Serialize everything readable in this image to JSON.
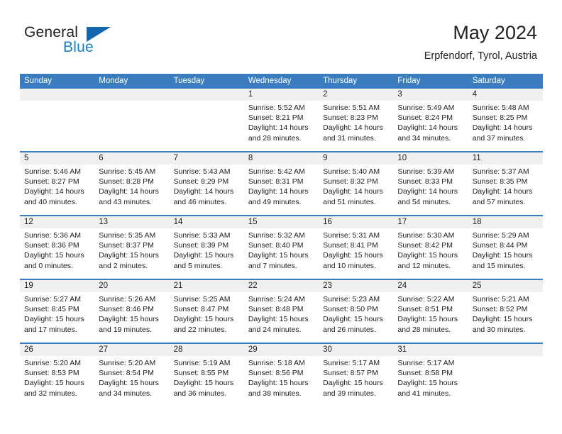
{
  "brand": {
    "name_part1": "General",
    "name_part2": "Blue",
    "accent_color": "#1566b0",
    "logo_icon": "triangle-flag-icon"
  },
  "header": {
    "title": "May 2024",
    "location": "Erpfendorf, Tyrol, Austria"
  },
  "theme": {
    "header_row_bg": "#3a7dbf",
    "week_separator": "#3a7dbf",
    "day_band_bg": "#f0f0f0",
    "text": "#222222"
  },
  "weekdays": [
    "Sunday",
    "Monday",
    "Tuesday",
    "Wednesday",
    "Thursday",
    "Friday",
    "Saturday"
  ],
  "weeks": [
    {
      "days": [
        {
          "number": "",
          "sunrise": "",
          "sunset": "",
          "daylight_line1": "",
          "daylight_line2": "",
          "empty": true
        },
        {
          "number": "",
          "sunrise": "",
          "sunset": "",
          "daylight_line1": "",
          "daylight_line2": "",
          "empty": true
        },
        {
          "number": "",
          "sunrise": "",
          "sunset": "",
          "daylight_line1": "",
          "daylight_line2": "",
          "empty": true
        },
        {
          "number": "1",
          "sunrise": "Sunrise: 5:52 AM",
          "sunset": "Sunset: 8:21 PM",
          "daylight_line1": "Daylight: 14 hours",
          "daylight_line2": "and 28 minutes.",
          "empty": false
        },
        {
          "number": "2",
          "sunrise": "Sunrise: 5:51 AM",
          "sunset": "Sunset: 8:23 PM",
          "daylight_line1": "Daylight: 14 hours",
          "daylight_line2": "and 31 minutes.",
          "empty": false
        },
        {
          "number": "3",
          "sunrise": "Sunrise: 5:49 AM",
          "sunset": "Sunset: 8:24 PM",
          "daylight_line1": "Daylight: 14 hours",
          "daylight_line2": "and 34 minutes.",
          "empty": false
        },
        {
          "number": "4",
          "sunrise": "Sunrise: 5:48 AM",
          "sunset": "Sunset: 8:25 PM",
          "daylight_line1": "Daylight: 14 hours",
          "daylight_line2": "and 37 minutes.",
          "empty": false
        }
      ]
    },
    {
      "days": [
        {
          "number": "5",
          "sunrise": "Sunrise: 5:46 AM",
          "sunset": "Sunset: 8:27 PM",
          "daylight_line1": "Daylight: 14 hours",
          "daylight_line2": "and 40 minutes.",
          "empty": false
        },
        {
          "number": "6",
          "sunrise": "Sunrise: 5:45 AM",
          "sunset": "Sunset: 8:28 PM",
          "daylight_line1": "Daylight: 14 hours",
          "daylight_line2": "and 43 minutes.",
          "empty": false
        },
        {
          "number": "7",
          "sunrise": "Sunrise: 5:43 AM",
          "sunset": "Sunset: 8:29 PM",
          "daylight_line1": "Daylight: 14 hours",
          "daylight_line2": "and 46 minutes.",
          "empty": false
        },
        {
          "number": "8",
          "sunrise": "Sunrise: 5:42 AM",
          "sunset": "Sunset: 8:31 PM",
          "daylight_line1": "Daylight: 14 hours",
          "daylight_line2": "and 49 minutes.",
          "empty": false
        },
        {
          "number": "9",
          "sunrise": "Sunrise: 5:40 AM",
          "sunset": "Sunset: 8:32 PM",
          "daylight_line1": "Daylight: 14 hours",
          "daylight_line2": "and 51 minutes.",
          "empty": false
        },
        {
          "number": "10",
          "sunrise": "Sunrise: 5:39 AM",
          "sunset": "Sunset: 8:33 PM",
          "daylight_line1": "Daylight: 14 hours",
          "daylight_line2": "and 54 minutes.",
          "empty": false
        },
        {
          "number": "11",
          "sunrise": "Sunrise: 5:37 AM",
          "sunset": "Sunset: 8:35 PM",
          "daylight_line1": "Daylight: 14 hours",
          "daylight_line2": "and 57 minutes.",
          "empty": false
        }
      ]
    },
    {
      "days": [
        {
          "number": "12",
          "sunrise": "Sunrise: 5:36 AM",
          "sunset": "Sunset: 8:36 PM",
          "daylight_line1": "Daylight: 15 hours",
          "daylight_line2": "and 0 minutes.",
          "empty": false
        },
        {
          "number": "13",
          "sunrise": "Sunrise: 5:35 AM",
          "sunset": "Sunset: 8:37 PM",
          "daylight_line1": "Daylight: 15 hours",
          "daylight_line2": "and 2 minutes.",
          "empty": false
        },
        {
          "number": "14",
          "sunrise": "Sunrise: 5:33 AM",
          "sunset": "Sunset: 8:39 PM",
          "daylight_line1": "Daylight: 15 hours",
          "daylight_line2": "and 5 minutes.",
          "empty": false
        },
        {
          "number": "15",
          "sunrise": "Sunrise: 5:32 AM",
          "sunset": "Sunset: 8:40 PM",
          "daylight_line1": "Daylight: 15 hours",
          "daylight_line2": "and 7 minutes.",
          "empty": false
        },
        {
          "number": "16",
          "sunrise": "Sunrise: 5:31 AM",
          "sunset": "Sunset: 8:41 PM",
          "daylight_line1": "Daylight: 15 hours",
          "daylight_line2": "and 10 minutes.",
          "empty": false
        },
        {
          "number": "17",
          "sunrise": "Sunrise: 5:30 AM",
          "sunset": "Sunset: 8:42 PM",
          "daylight_line1": "Daylight: 15 hours",
          "daylight_line2": "and 12 minutes.",
          "empty": false
        },
        {
          "number": "18",
          "sunrise": "Sunrise: 5:29 AM",
          "sunset": "Sunset: 8:44 PM",
          "daylight_line1": "Daylight: 15 hours",
          "daylight_line2": "and 15 minutes.",
          "empty": false
        }
      ]
    },
    {
      "days": [
        {
          "number": "19",
          "sunrise": "Sunrise: 5:27 AM",
          "sunset": "Sunset: 8:45 PM",
          "daylight_line1": "Daylight: 15 hours",
          "daylight_line2": "and 17 minutes.",
          "empty": false
        },
        {
          "number": "20",
          "sunrise": "Sunrise: 5:26 AM",
          "sunset": "Sunset: 8:46 PM",
          "daylight_line1": "Daylight: 15 hours",
          "daylight_line2": "and 19 minutes.",
          "empty": false
        },
        {
          "number": "21",
          "sunrise": "Sunrise: 5:25 AM",
          "sunset": "Sunset: 8:47 PM",
          "daylight_line1": "Daylight: 15 hours",
          "daylight_line2": "and 22 minutes.",
          "empty": false
        },
        {
          "number": "22",
          "sunrise": "Sunrise: 5:24 AM",
          "sunset": "Sunset: 8:48 PM",
          "daylight_line1": "Daylight: 15 hours",
          "daylight_line2": "and 24 minutes.",
          "empty": false
        },
        {
          "number": "23",
          "sunrise": "Sunrise: 5:23 AM",
          "sunset": "Sunset: 8:50 PM",
          "daylight_line1": "Daylight: 15 hours",
          "daylight_line2": "and 26 minutes.",
          "empty": false
        },
        {
          "number": "24",
          "sunrise": "Sunrise: 5:22 AM",
          "sunset": "Sunset: 8:51 PM",
          "daylight_line1": "Daylight: 15 hours",
          "daylight_line2": "and 28 minutes.",
          "empty": false
        },
        {
          "number": "25",
          "sunrise": "Sunrise: 5:21 AM",
          "sunset": "Sunset: 8:52 PM",
          "daylight_line1": "Daylight: 15 hours",
          "daylight_line2": "and 30 minutes.",
          "empty": false
        }
      ]
    },
    {
      "days": [
        {
          "number": "26",
          "sunrise": "Sunrise: 5:20 AM",
          "sunset": "Sunset: 8:53 PM",
          "daylight_line1": "Daylight: 15 hours",
          "daylight_line2": "and 32 minutes.",
          "empty": false
        },
        {
          "number": "27",
          "sunrise": "Sunrise: 5:20 AM",
          "sunset": "Sunset: 8:54 PM",
          "daylight_line1": "Daylight: 15 hours",
          "daylight_line2": "and 34 minutes.",
          "empty": false
        },
        {
          "number": "28",
          "sunrise": "Sunrise: 5:19 AM",
          "sunset": "Sunset: 8:55 PM",
          "daylight_line1": "Daylight: 15 hours",
          "daylight_line2": "and 36 minutes.",
          "empty": false
        },
        {
          "number": "29",
          "sunrise": "Sunrise: 5:18 AM",
          "sunset": "Sunset: 8:56 PM",
          "daylight_line1": "Daylight: 15 hours",
          "daylight_line2": "and 38 minutes.",
          "empty": false
        },
        {
          "number": "30",
          "sunrise": "Sunrise: 5:17 AM",
          "sunset": "Sunset: 8:57 PM",
          "daylight_line1": "Daylight: 15 hours",
          "daylight_line2": "and 39 minutes.",
          "empty": false
        },
        {
          "number": "31",
          "sunrise": "Sunrise: 5:17 AM",
          "sunset": "Sunset: 8:58 PM",
          "daylight_line1": "Daylight: 15 hours",
          "daylight_line2": "and 41 minutes.",
          "empty": false
        },
        {
          "number": "",
          "sunrise": "",
          "sunset": "",
          "daylight_line1": "",
          "daylight_line2": "",
          "empty": true
        }
      ]
    }
  ]
}
